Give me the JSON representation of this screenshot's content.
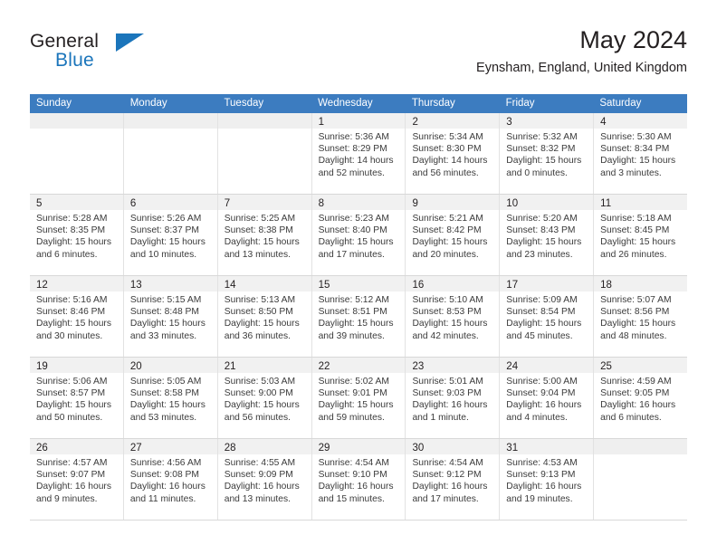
{
  "brand": {
    "name_part1": "General",
    "name_part2": "Blue",
    "accent_color": "#1b75bb",
    "logo_icon": "triangle-flag-icon"
  },
  "header": {
    "title": "May 2024",
    "subtitle": "Eynsham, England, United Kingdom"
  },
  "calendar": {
    "header_bg": "#3c7cc0",
    "day_names": [
      "Sunday",
      "Monday",
      "Tuesday",
      "Wednesday",
      "Thursday",
      "Friday",
      "Saturday"
    ],
    "labels": {
      "sunrise": "Sunrise:",
      "sunset": "Sunset:",
      "daylight": "Daylight:"
    },
    "weeks": [
      [
        {
          "day": "",
          "sunrise": "",
          "sunset": "",
          "daylight_line1": "",
          "daylight_line2": ""
        },
        {
          "day": "",
          "sunrise": "",
          "sunset": "",
          "daylight_line1": "",
          "daylight_line2": ""
        },
        {
          "day": "",
          "sunrise": "",
          "sunset": "",
          "daylight_line1": "",
          "daylight_line2": ""
        },
        {
          "day": "1",
          "sunrise": "Sunrise: 5:36 AM",
          "sunset": "Sunset: 8:29 PM",
          "daylight_line1": "Daylight: 14 hours",
          "daylight_line2": "and 52 minutes."
        },
        {
          "day": "2",
          "sunrise": "Sunrise: 5:34 AM",
          "sunset": "Sunset: 8:30 PM",
          "daylight_line1": "Daylight: 14 hours",
          "daylight_line2": "and 56 minutes."
        },
        {
          "day": "3",
          "sunrise": "Sunrise: 5:32 AM",
          "sunset": "Sunset: 8:32 PM",
          "daylight_line1": "Daylight: 15 hours",
          "daylight_line2": "and 0 minutes."
        },
        {
          "day": "4",
          "sunrise": "Sunrise: 5:30 AM",
          "sunset": "Sunset: 8:34 PM",
          "daylight_line1": "Daylight: 15 hours",
          "daylight_line2": "and 3 minutes."
        }
      ],
      [
        {
          "day": "5",
          "sunrise": "Sunrise: 5:28 AM",
          "sunset": "Sunset: 8:35 PM",
          "daylight_line1": "Daylight: 15 hours",
          "daylight_line2": "and 6 minutes."
        },
        {
          "day": "6",
          "sunrise": "Sunrise: 5:26 AM",
          "sunset": "Sunset: 8:37 PM",
          "daylight_line1": "Daylight: 15 hours",
          "daylight_line2": "and 10 minutes."
        },
        {
          "day": "7",
          "sunrise": "Sunrise: 5:25 AM",
          "sunset": "Sunset: 8:38 PM",
          "daylight_line1": "Daylight: 15 hours",
          "daylight_line2": "and 13 minutes."
        },
        {
          "day": "8",
          "sunrise": "Sunrise: 5:23 AM",
          "sunset": "Sunset: 8:40 PM",
          "daylight_line1": "Daylight: 15 hours",
          "daylight_line2": "and 17 minutes."
        },
        {
          "day": "9",
          "sunrise": "Sunrise: 5:21 AM",
          "sunset": "Sunset: 8:42 PM",
          "daylight_line1": "Daylight: 15 hours",
          "daylight_line2": "and 20 minutes."
        },
        {
          "day": "10",
          "sunrise": "Sunrise: 5:20 AM",
          "sunset": "Sunset: 8:43 PM",
          "daylight_line1": "Daylight: 15 hours",
          "daylight_line2": "and 23 minutes."
        },
        {
          "day": "11",
          "sunrise": "Sunrise: 5:18 AM",
          "sunset": "Sunset: 8:45 PM",
          "daylight_line1": "Daylight: 15 hours",
          "daylight_line2": "and 26 minutes."
        }
      ],
      [
        {
          "day": "12",
          "sunrise": "Sunrise: 5:16 AM",
          "sunset": "Sunset: 8:46 PM",
          "daylight_line1": "Daylight: 15 hours",
          "daylight_line2": "and 30 minutes."
        },
        {
          "day": "13",
          "sunrise": "Sunrise: 5:15 AM",
          "sunset": "Sunset: 8:48 PM",
          "daylight_line1": "Daylight: 15 hours",
          "daylight_line2": "and 33 minutes."
        },
        {
          "day": "14",
          "sunrise": "Sunrise: 5:13 AM",
          "sunset": "Sunset: 8:50 PM",
          "daylight_line1": "Daylight: 15 hours",
          "daylight_line2": "and 36 minutes."
        },
        {
          "day": "15",
          "sunrise": "Sunrise: 5:12 AM",
          "sunset": "Sunset: 8:51 PM",
          "daylight_line1": "Daylight: 15 hours",
          "daylight_line2": "and 39 minutes."
        },
        {
          "day": "16",
          "sunrise": "Sunrise: 5:10 AM",
          "sunset": "Sunset: 8:53 PM",
          "daylight_line1": "Daylight: 15 hours",
          "daylight_line2": "and 42 minutes."
        },
        {
          "day": "17",
          "sunrise": "Sunrise: 5:09 AM",
          "sunset": "Sunset: 8:54 PM",
          "daylight_line1": "Daylight: 15 hours",
          "daylight_line2": "and 45 minutes."
        },
        {
          "day": "18",
          "sunrise": "Sunrise: 5:07 AM",
          "sunset": "Sunset: 8:56 PM",
          "daylight_line1": "Daylight: 15 hours",
          "daylight_line2": "and 48 minutes."
        }
      ],
      [
        {
          "day": "19",
          "sunrise": "Sunrise: 5:06 AM",
          "sunset": "Sunset: 8:57 PM",
          "daylight_line1": "Daylight: 15 hours",
          "daylight_line2": "and 50 minutes."
        },
        {
          "day": "20",
          "sunrise": "Sunrise: 5:05 AM",
          "sunset": "Sunset: 8:58 PM",
          "daylight_line1": "Daylight: 15 hours",
          "daylight_line2": "and 53 minutes."
        },
        {
          "day": "21",
          "sunrise": "Sunrise: 5:03 AM",
          "sunset": "Sunset: 9:00 PM",
          "daylight_line1": "Daylight: 15 hours",
          "daylight_line2": "and 56 minutes."
        },
        {
          "day": "22",
          "sunrise": "Sunrise: 5:02 AM",
          "sunset": "Sunset: 9:01 PM",
          "daylight_line1": "Daylight: 15 hours",
          "daylight_line2": "and 59 minutes."
        },
        {
          "day": "23",
          "sunrise": "Sunrise: 5:01 AM",
          "sunset": "Sunset: 9:03 PM",
          "daylight_line1": "Daylight: 16 hours",
          "daylight_line2": "and 1 minute."
        },
        {
          "day": "24",
          "sunrise": "Sunrise: 5:00 AM",
          "sunset": "Sunset: 9:04 PM",
          "daylight_line1": "Daylight: 16 hours",
          "daylight_line2": "and 4 minutes."
        },
        {
          "day": "25",
          "sunrise": "Sunrise: 4:59 AM",
          "sunset": "Sunset: 9:05 PM",
          "daylight_line1": "Daylight: 16 hours",
          "daylight_line2": "and 6 minutes."
        }
      ],
      [
        {
          "day": "26",
          "sunrise": "Sunrise: 4:57 AM",
          "sunset": "Sunset: 9:07 PM",
          "daylight_line1": "Daylight: 16 hours",
          "daylight_line2": "and 9 minutes."
        },
        {
          "day": "27",
          "sunrise": "Sunrise: 4:56 AM",
          "sunset": "Sunset: 9:08 PM",
          "daylight_line1": "Daylight: 16 hours",
          "daylight_line2": "and 11 minutes."
        },
        {
          "day": "28",
          "sunrise": "Sunrise: 4:55 AM",
          "sunset": "Sunset: 9:09 PM",
          "daylight_line1": "Daylight: 16 hours",
          "daylight_line2": "and 13 minutes."
        },
        {
          "day": "29",
          "sunrise": "Sunrise: 4:54 AM",
          "sunset": "Sunset: 9:10 PM",
          "daylight_line1": "Daylight: 16 hours",
          "daylight_line2": "and 15 minutes."
        },
        {
          "day": "30",
          "sunrise": "Sunrise: 4:54 AM",
          "sunset": "Sunset: 9:12 PM",
          "daylight_line1": "Daylight: 16 hours",
          "daylight_line2": "and 17 minutes."
        },
        {
          "day": "31",
          "sunrise": "Sunrise: 4:53 AM",
          "sunset": "Sunset: 9:13 PM",
          "daylight_line1": "Daylight: 16 hours",
          "daylight_line2": "and 19 minutes."
        },
        {
          "day": "",
          "sunrise": "",
          "sunset": "",
          "daylight_line1": "",
          "daylight_line2": ""
        }
      ]
    ]
  }
}
